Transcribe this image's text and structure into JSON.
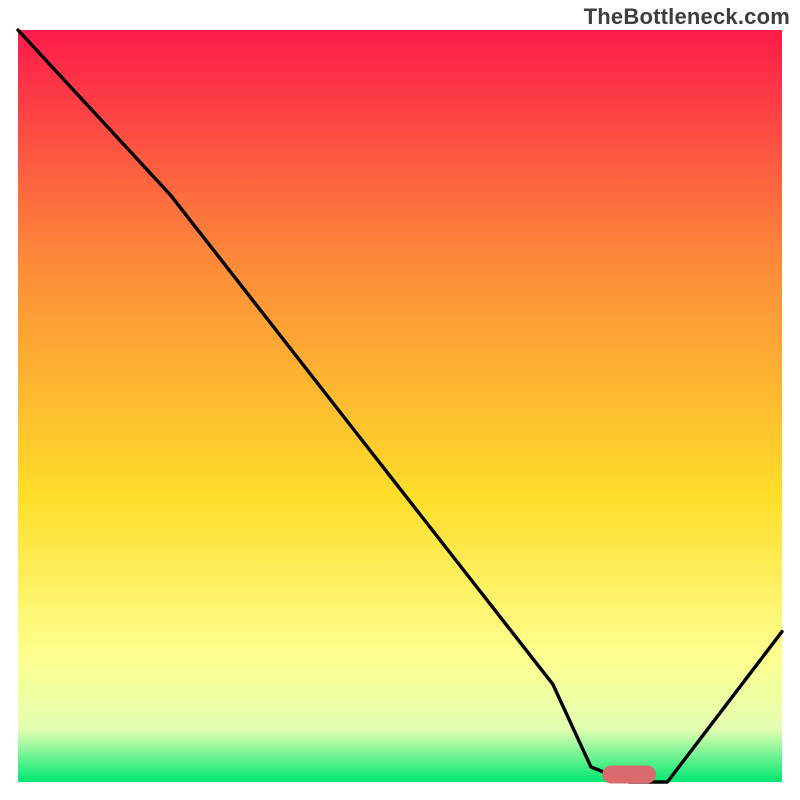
{
  "watermark": {
    "text": "TheBottleneck.com"
  },
  "colors": {
    "gradient_top": "#fd1b4a",
    "gradient_mid_upper": "#fd883a",
    "gradient_mid": "#fede29",
    "gradient_light": "#feff8e",
    "gradient_pale": "#e3ffb2",
    "gradient_green": "#00e873",
    "curve": "#000000",
    "marker": "#db6a6e"
  },
  "chart_data": {
    "type": "line",
    "title": "",
    "xlabel": "",
    "ylabel": "",
    "xlim": [
      0,
      100
    ],
    "ylim": [
      0,
      100
    ],
    "grid": false,
    "legend": false,
    "axes_visible": false,
    "gradient_background": true,
    "series": [
      {
        "name": "bottleneck-curve",
        "x": [
          0,
          20,
          40,
          60,
          70,
          75,
          80,
          85,
          100
        ],
        "values": [
          100,
          78,
          52,
          26,
          13,
          2,
          0,
          0,
          20
        ],
        "note": "values are percent height from bottom (0 = bottom / green, 100 = top / red). Shape: steep drop from top-left, slight knee around x≈20, continues down to a flat trough around x≈78–85, then rises toward the right edge."
      }
    ],
    "marker": {
      "name": "optimal-range",
      "shape": "pill",
      "x_center": 80,
      "y_value": 1,
      "width_percent": 7,
      "note": "Small horizontal pink pill sitting in the trough of the curve, very close to the bottom green band."
    }
  }
}
